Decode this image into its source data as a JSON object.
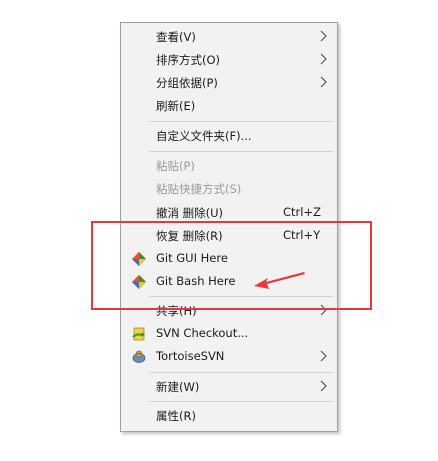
{
  "menu": {
    "items": [
      {
        "label": "查看(V)",
        "has_submenu": true
      },
      {
        "label": "排序方式(O)",
        "has_submenu": true
      },
      {
        "label": "分组依据(P)",
        "has_submenu": true
      },
      {
        "label": "刷新(E)"
      },
      {
        "label": "自定义文件夹(F)..."
      },
      {
        "label": "粘贴(P)",
        "disabled": true
      },
      {
        "label": "粘贴快捷方式(S)",
        "disabled": true
      },
      {
        "label": "撤消 删除(U)",
        "shortcut": "Ctrl+Z"
      },
      {
        "label": "恢复 删除(R)",
        "shortcut": "Ctrl+Y"
      },
      {
        "label": "Git GUI Here",
        "icon": "git-icon"
      },
      {
        "label": "Git Bash Here",
        "icon": "git-icon"
      },
      {
        "label": "共享(H)",
        "has_submenu": true
      },
      {
        "label": "SVN Checkout...",
        "icon": "svn-checkout-icon"
      },
      {
        "label": "TortoiseSVN",
        "icon": "tortoisesvn-icon",
        "has_submenu": true
      },
      {
        "label": "新建(W)",
        "has_submenu": true
      },
      {
        "label": "属性(R)"
      }
    ]
  },
  "annotation": {
    "box_color": "#e8383d",
    "arrow_color": "#e8383d"
  }
}
